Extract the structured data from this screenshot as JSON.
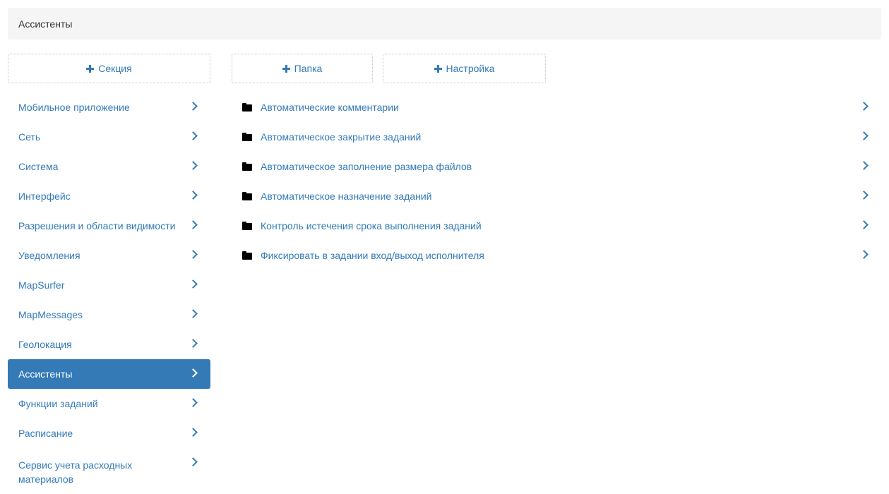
{
  "breadcrumb": {
    "title": "Ассистенты"
  },
  "toolbar": {
    "add_section_label": "Секция",
    "add_folder_label": "Папка",
    "add_setting_label": "Настройка"
  },
  "sidebar": {
    "items": [
      {
        "label": "Мобильное приложение"
      },
      {
        "label": "Сеть"
      },
      {
        "label": "Система"
      },
      {
        "label": "Интерфейс"
      },
      {
        "label": "Разрешения и области видимости"
      },
      {
        "label": "Уведомления"
      },
      {
        "label": "MapSurfer"
      },
      {
        "label": "MapMessages"
      },
      {
        "label": "Геолокация"
      },
      {
        "label": "Ассистенты",
        "active": true
      },
      {
        "label": "Функции заданий"
      },
      {
        "label": "Расписание"
      },
      {
        "label": "Сервис учета расходных материалов"
      }
    ]
  },
  "folders": {
    "items": [
      {
        "label": "Автоматические комментарии"
      },
      {
        "label": "Автоматическое закрытие заданий"
      },
      {
        "label": "Автоматическое заполнение размера файлов"
      },
      {
        "label": "Автоматическое назначение заданий"
      },
      {
        "label": "Контроль истечения срока выполнения заданий"
      },
      {
        "label": "Фиксировать в задании вход/выход исполнителя"
      }
    ]
  },
  "colors": {
    "accent": "#337ab7",
    "breadcrumb_bg": "#f5f5f5"
  },
  "icons": {
    "add": "plus-icon",
    "folder": "folder-icon",
    "arrow": "chevron-right-icon"
  }
}
